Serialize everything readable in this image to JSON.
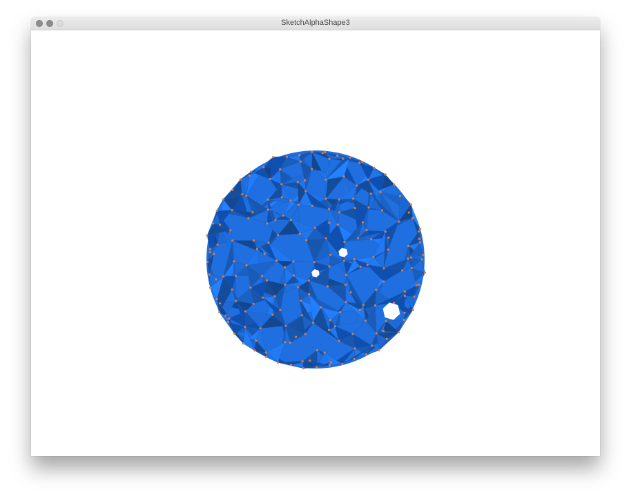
{
  "window": {
    "title": "SketchAlphaShape3",
    "buttons": [
      "close",
      "minimize",
      "zoom"
    ]
  },
  "canvas": {
    "background_color": "#ffffff",
    "shape_color": "#1f6fe0",
    "shape_dark_color": "#0f4fb0",
    "vertex_color": "#e07b3a",
    "shape_kind": "3D alpha shape of a sphere with triangulated faces and orange vertex points"
  }
}
